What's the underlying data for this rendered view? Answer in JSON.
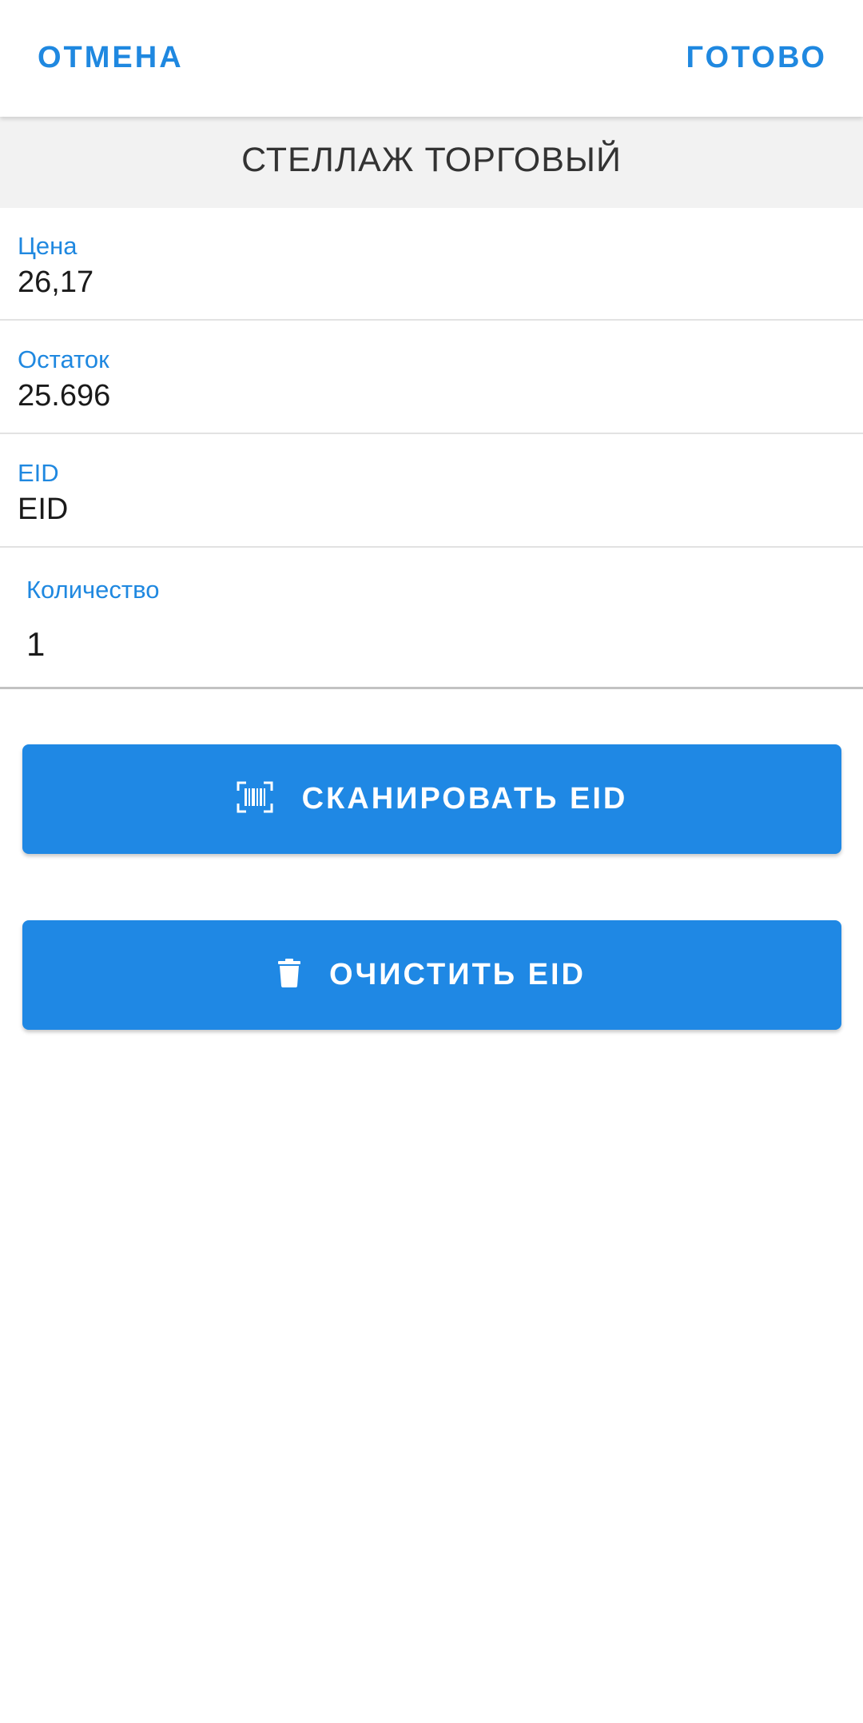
{
  "toolbar": {
    "cancel_label": "ОТМЕНА",
    "done_label": "ГОТОВО"
  },
  "header": {
    "title": "СТЕЛЛАЖ ТОРГОВЫЙ"
  },
  "details": {
    "price": {
      "label": "Цена",
      "value": "26,17"
    },
    "stock": {
      "label": "Остаток",
      "value": "25.696"
    },
    "eid": {
      "label": "EID",
      "value": "EID"
    }
  },
  "quantity": {
    "label": "Количество",
    "value": "1"
  },
  "actions": {
    "scan": {
      "label": "СКАНИРОВАТЬ EID",
      "icon": "barcode-scan-icon"
    },
    "clear": {
      "label": "ОЧИСТИТЬ EID",
      "icon": "trash-icon"
    }
  },
  "colors": {
    "accent": "#1f88e0",
    "button_bg": "#1f88e4",
    "title_band_bg": "#f2f2f2",
    "text_dark": "#1a1a1a"
  }
}
